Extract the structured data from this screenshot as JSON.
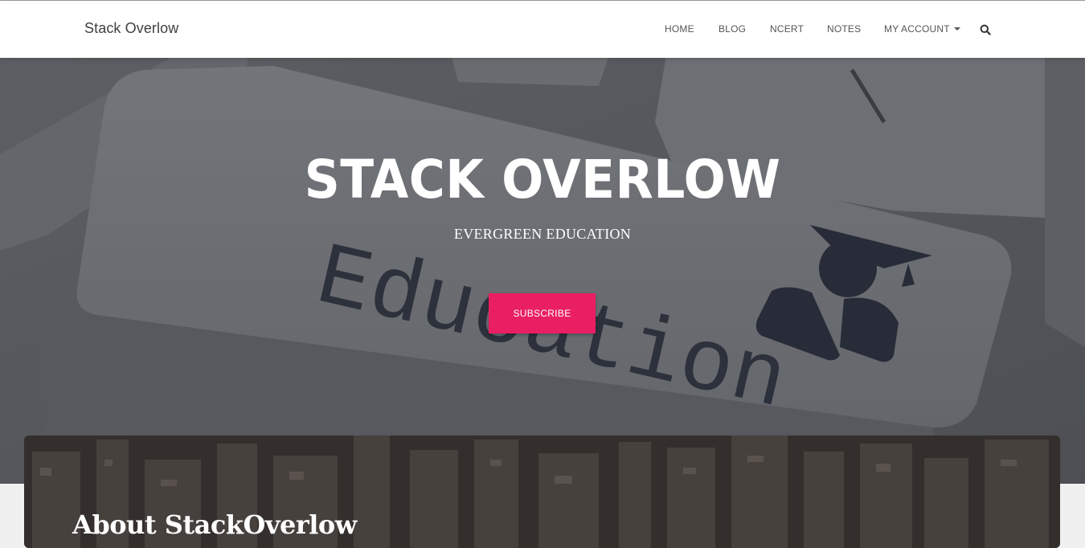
{
  "nav": {
    "brand": "Stack Overlow",
    "items": [
      {
        "label": "HOME"
      },
      {
        "label": "BLOG"
      },
      {
        "label": "NCERT"
      },
      {
        "label": "NOTES"
      },
      {
        "label": "MY ACCOUNT"
      }
    ],
    "search_icon": "search-icon"
  },
  "hero": {
    "title": "STACK OVERLOW",
    "subtitle": "EVERGREEN EDUCATION",
    "cta_label": "SUBSCRIBE",
    "keyboard_text": "Education",
    "graduate_icon": "graduate-icon"
  },
  "about": {
    "title": "About StackOverlow"
  },
  "colors": {
    "accent": "#e91e63",
    "nav_bg": "#ffffff",
    "hero_overlay": "#5e6066",
    "nav_text": "#555555"
  }
}
